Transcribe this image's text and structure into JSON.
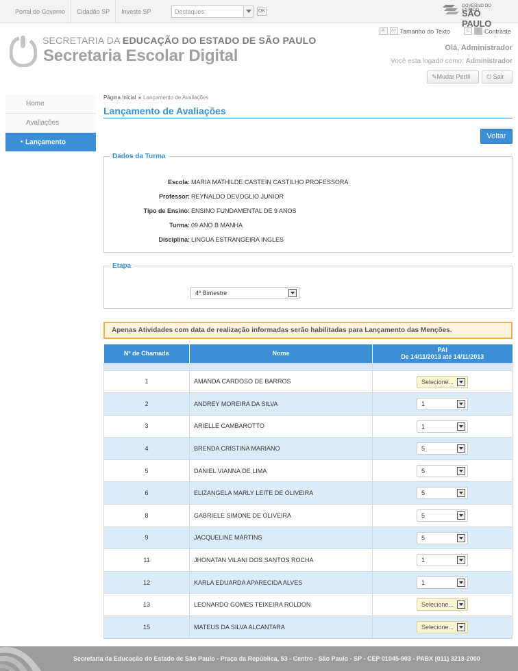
{
  "topbar": {
    "links": [
      "Portal do Governo",
      "Cidadão SP",
      "Investe SP"
    ],
    "destaques_placeholder": "Destaques:",
    "ok_label": "OK",
    "gov_logo_small": "GOVERNO DO ESTADO",
    "gov_logo_big": "SÃO PAULO"
  },
  "header": {
    "brand_line1_prefix": "SECRETARIA DA ",
    "brand_line1_bold": "EDUCAÇÃO DO ESTADO DE SÃO PAULO",
    "brand_line2": "Secretaria Escolar Digital",
    "text_size_minus": "A-",
    "text_size_plus": "A+",
    "text_size_label": "Tamanho do Texto",
    "contrast_c": "C",
    "contrast_label": "Contraste",
    "greeting": "Olá, Administrador",
    "logged_prefix": "Você esta logado como: ",
    "logged_user": "Administrador",
    "mudar_perfil": "Mudar Perfil",
    "sair": "Sair"
  },
  "sidebar": {
    "items": [
      {
        "label": "Home"
      },
      {
        "label": "Avaliações"
      },
      {
        "label": "Lançamento"
      }
    ]
  },
  "breadcrumb": {
    "home": "Página Inicial",
    "separator": "»",
    "current": "Lançamento de Avaliações"
  },
  "page": {
    "title": "Lançamento de Avaliações",
    "voltar": "Voltar"
  },
  "turma": {
    "legend": "Dados da Turma",
    "fields": [
      {
        "label": "Escola:",
        "value": "MARIA MATHILDE CASTEIN CASTILHO PROFESSORA"
      },
      {
        "label": "Professor:",
        "value": "REYNALDO DEVOGLIO JUNIOR"
      },
      {
        "label": "Tipo de Ensino:",
        "value": "ENSINO FUNDAMENTAL DE 9 ANOS"
      },
      {
        "label": "Turma:",
        "value": "09 ANO B MANHA"
      },
      {
        "label": "Disciplina:",
        "value": "LINGUA ESTRANGEIRA INGLES"
      }
    ]
  },
  "etapa": {
    "legend": "Etapa",
    "selected": "4º Bimestre"
  },
  "notice": "Apenas Atividades com data de realização informadas serão habilitadas para Lançamento das Menções.",
  "table": {
    "col_chamada": "Nº de Chamada",
    "col_nome": "Nome",
    "col_pai": "PAI",
    "col_pai_range": "De 14/11/2013 até 14/11/2013",
    "rows": [
      {
        "num": "1",
        "nome": "AMANDA CARDOSO DE BARROS",
        "mencao": "Selecione..."
      },
      {
        "num": "2",
        "nome": "ANDREY MOREIRA DA SILVA",
        "mencao": "1"
      },
      {
        "num": "3",
        "nome": "ARIELLE CAMBAROTTO",
        "mencao": "1"
      },
      {
        "num": "4",
        "nome": "BRENDA CRISTINA MARIANO",
        "mencao": "5"
      },
      {
        "num": "5",
        "nome": "DANIEL VIANNA DE LIMA",
        "mencao": "5"
      },
      {
        "num": "6",
        "nome": "ELIZANGELA MARLY LEITE DE OLIVEIRA",
        "mencao": "5"
      },
      {
        "num": "8",
        "nome": "GABRIELE SIMONE DE OLIVEIRA",
        "mencao": "5"
      },
      {
        "num": "9",
        "nome": "JACQUELINE MARTINS",
        "mencao": "5"
      },
      {
        "num": "11",
        "nome": "JHONATAN VILANI DOS SANTOS ROCHA",
        "mencao": "1"
      },
      {
        "num": "12",
        "nome": "KARLA EDUARDA APARECIDA ALVES",
        "mencao": "1"
      },
      {
        "num": "13",
        "nome": "LEONARDO GOMES TEIXEIRA ROLDON",
        "mencao": "Selecione..."
      },
      {
        "num": "15",
        "nome": "MATEUS DA SILVA ALCANTARA",
        "mencao": "Selecione..."
      }
    ]
  },
  "footer": {
    "text": "Secretaria da Educação do Estado de São Paulo - Praça da República, 53 - Centro - São Paulo - SP - CEP 01045-903 - PABX (011) 3218-2000"
  },
  "colors": {
    "accent": "#3a8fd6",
    "notice_border": "#f0b04a",
    "row_alt": "#dcebf8"
  }
}
